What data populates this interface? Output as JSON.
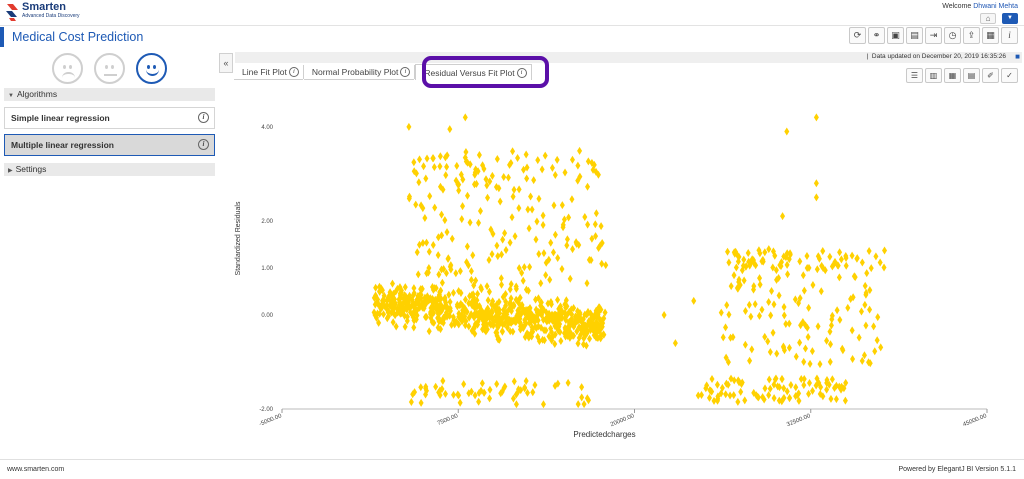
{
  "header": {
    "logo_name": "Smarten",
    "logo_sub": "Advanced Data Discovery",
    "welcome_prefix": "Welcome",
    "user_name": "Dhwani Mehta"
  },
  "page": {
    "title": "Medical Cost Prediction",
    "toolbar_icons": [
      "refresh-icon",
      "link-icon",
      "save-icon",
      "save-as-icon",
      "export-icon",
      "schedule-icon",
      "share-icon",
      "grid-icon",
      "info-icon"
    ]
  },
  "sidebar": {
    "algorithms_label": "Algorithms",
    "items": [
      {
        "label": "Simple linear regression",
        "selected": false
      },
      {
        "label": "Multiple linear regression",
        "selected": true
      }
    ],
    "settings_label": "Settings"
  },
  "status": {
    "updated_text": "Data updated on December 20, 2019 16:35:26"
  },
  "tabs": [
    {
      "label": "Line Fit Plot",
      "active": false
    },
    {
      "label": "Normal Probability Plot",
      "active": false
    },
    {
      "label": "Residual Versus Fit Plot",
      "active": true
    }
  ],
  "plot_tool_icons": [
    "list-icon",
    "filter-table-icon",
    "table-icon",
    "rows-icon",
    "brush-icon",
    "check-icon"
  ],
  "colors": {
    "accent": "#1e5ab5",
    "point": "#FFD100",
    "highlight": "#5b0fa8"
  },
  "chart_data": {
    "type": "scatter",
    "xlabel": "Predictedcharges",
    "ylabel": "Standardized Residuals",
    "xlim": [
      -5000,
      45000
    ],
    "ylim": [
      -2,
      4.4
    ],
    "xticks": [
      -5000,
      7500,
      20000,
      32500,
      45000
    ],
    "xtick_labels": [
      "-5000.00",
      "7500.00",
      "20000.00",
      "32500.00",
      "45000.00"
    ],
    "yticks": [
      -2,
      0,
      1,
      2,
      4
    ],
    "ytick_labels": [
      "-2.00",
      "0.00",
      "1.00",
      "2.00",
      "4.00"
    ],
    "grid": false,
    "marker": "diamond",
    "clusters": [
      {
        "x_range": [
          1500,
          18000
        ],
        "y_center": 0.0,
        "y_spread": 0.35,
        "slope": -0.03,
        "count": 700
      },
      {
        "x_range": [
          4000,
          17000
        ],
        "y_range": [
          -1.9,
          -1.4
        ],
        "count": 60
      },
      {
        "x_range": [
          4000,
          18000
        ],
        "y_range": [
          0.5,
          3.5
        ],
        "count": 210
      },
      {
        "x_range": [
          24500,
          35000
        ],
        "y_range": [
          -1.85,
          -1.35
        ],
        "count": 90
      },
      {
        "x_range": [
          26000,
          37500
        ],
        "y_range": [
          -1.1,
          0.9
        ],
        "count": 110
      },
      {
        "x_range": [
          26500,
          38000
        ],
        "y_range": [
          0.95,
          1.4
        ],
        "count": 75
      }
    ],
    "points": [
      {
        "x": 4000,
        "y": 4.0
      },
      {
        "x": 8000,
        "y": 4.2
      },
      {
        "x": 6900,
        "y": 3.95
      },
      {
        "x": 30800,
        "y": 3.9
      },
      {
        "x": 32900,
        "y": 4.2
      },
      {
        "x": 32900,
        "y": 2.8
      },
      {
        "x": 32900,
        "y": 2.5
      },
      {
        "x": 30500,
        "y": 2.1
      },
      {
        "x": 22100,
        "y": 0.0
      },
      {
        "x": 22900,
        "y": -0.6
      },
      {
        "x": 24200,
        "y": 0.3
      },
      {
        "x": 5200,
        "y": 2.9
      },
      {
        "x": 9000,
        "y": 3.4
      },
      {
        "x": 15600,
        "y": 3.3
      }
    ]
  },
  "footer": {
    "left": "www.smarten.com",
    "right": "Powered by ElegantJ BI Version 5.1.1"
  }
}
